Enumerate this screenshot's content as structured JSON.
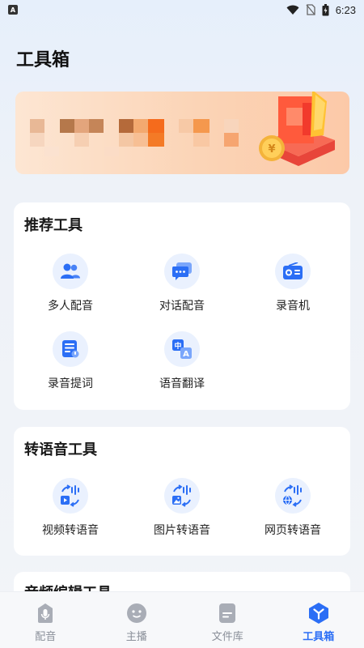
{
  "status_bar": {
    "time": "6:23",
    "notification_letter": "A"
  },
  "page_title": "工具箱",
  "colors": {
    "accent": "#2b6ef5",
    "icon_bg": "#eaf1fe",
    "tab_inactive": "#8a8f99"
  },
  "sections": [
    {
      "title": "推荐工具",
      "tools": [
        {
          "label": "多人配音",
          "icon": "people-icon"
        },
        {
          "label": "对话配音",
          "icon": "chat-bubble-icon"
        },
        {
          "label": "录音机",
          "icon": "radio-recorder-icon"
        },
        {
          "label": "录音提词",
          "icon": "teleprompter-icon"
        },
        {
          "label": "语音翻译",
          "icon": "translate-icon"
        }
      ]
    },
    {
      "title": "转语音工具",
      "tools": [
        {
          "label": "视频转语音",
          "icon": "video-to-speech-icon"
        },
        {
          "label": "图片转语音",
          "icon": "image-to-speech-icon"
        },
        {
          "label": "网页转语音",
          "icon": "web-to-speech-icon"
        }
      ]
    },
    {
      "title": "音频编辑工具"
    }
  ],
  "tabbar": [
    {
      "label": "配音",
      "icon": "dubbing-icon",
      "active": false
    },
    {
      "label": "主播",
      "icon": "anchor-icon",
      "active": false
    },
    {
      "label": "文件库",
      "icon": "file-library-icon",
      "active": false
    },
    {
      "label": "工具箱",
      "icon": "toolbox-icon",
      "active": true
    }
  ]
}
